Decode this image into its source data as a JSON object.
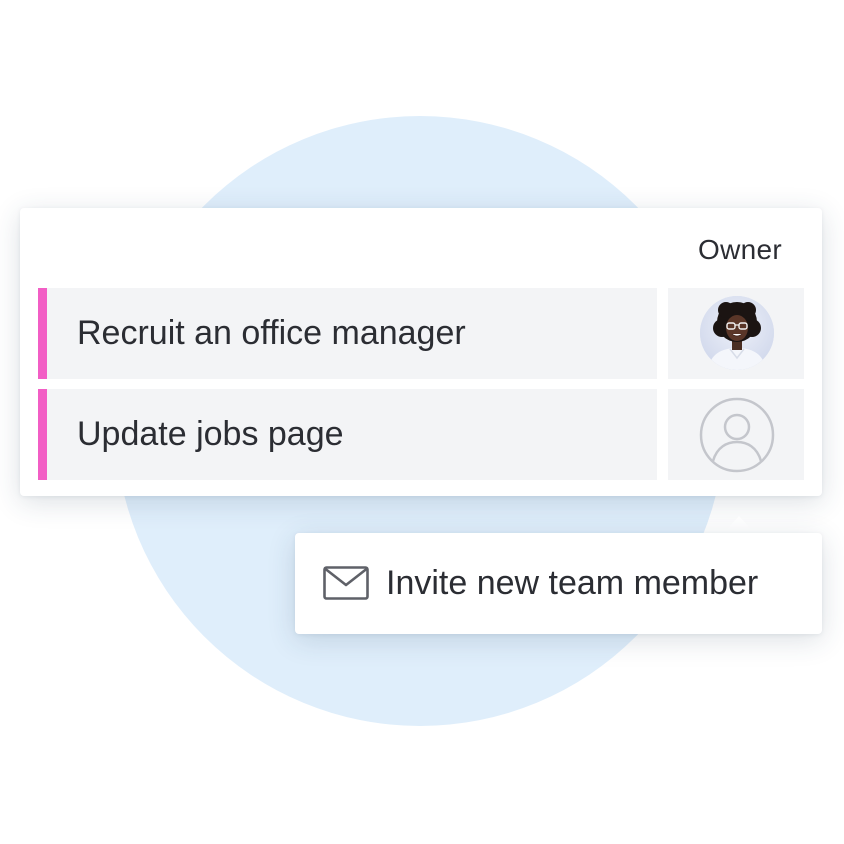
{
  "table": {
    "owner_header": "Owner",
    "tasks": [
      {
        "label": "Recruit an office manager",
        "owner": "assigned-user-photo"
      },
      {
        "label": "Update jobs page",
        "owner": "unassigned-user-icon"
      }
    ]
  },
  "tooltip": {
    "icon": "mail-icon",
    "label": "Invite new team member"
  },
  "colors": {
    "accent": "#f25ec5",
    "background_circle": "#dfeefb",
    "row_background": "#f3f4f6",
    "text": "#2b2d33",
    "icon_gray": "#c4c6cc"
  }
}
